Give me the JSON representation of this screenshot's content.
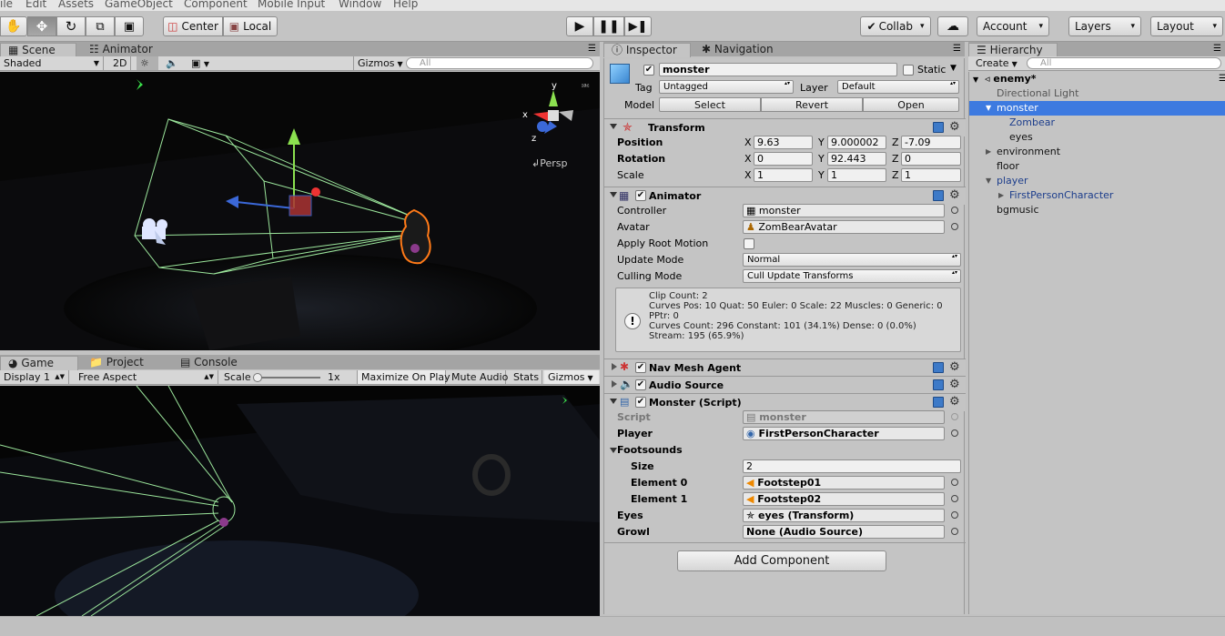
{
  "menu": [
    "ile",
    "Edit",
    "Assets",
    "GameObject",
    "Component",
    "Mobile Input",
    "Window",
    "Help"
  ],
  "toolbar": {
    "pivot_label": "Center",
    "space_label": "Local",
    "collab_label": "Collab",
    "account_label": "Account",
    "layers_label": "Layers",
    "layout_label": "Layout"
  },
  "scene": {
    "tabs": [
      "Scene",
      "Animator"
    ],
    "shading": "Shaded",
    "mode_2d": "2D",
    "gizmos": "Gizmos",
    "search_placeholder": "All",
    "persp_label": "Persp",
    "axis_y": "y",
    "axis_x": "x",
    "axis_z": "z"
  },
  "game": {
    "tabs": [
      "Game",
      "Project",
      "Console"
    ],
    "display": "Display 1",
    "aspect": "Free Aspect",
    "scale_label": "Scale",
    "scale_value": "1x",
    "maximize": "Maximize On Play",
    "mute": "Mute Audio",
    "stats": "Stats",
    "gizmos": "Gizmos"
  },
  "inspector": {
    "tabs": [
      "Inspector",
      "Navigation"
    ],
    "object_name": "monster",
    "static_label": "Static",
    "tag_label": "Tag",
    "tag_value": "Untagged",
    "layer_label": "Layer",
    "layer_value": "Default",
    "model_label": "Model",
    "model_buttons": [
      "Select",
      "Revert",
      "Open"
    ],
    "transform": {
      "title": "Transform",
      "position_label": "Position",
      "rotation_label": "Rotation",
      "scale_label": "Scale",
      "position": [
        "9.63",
        "9.000002",
        "-7.09"
      ],
      "rotation": [
        "0",
        "92.443",
        "0"
      ],
      "scale": [
        "1",
        "1",
        "1"
      ]
    },
    "animator": {
      "title": "Animator",
      "controller_label": "Controller",
      "controller_value": "monster",
      "avatar_label": "Avatar",
      "avatar_value": "ZomBearAvatar",
      "root_motion_label": "Apply Root Motion",
      "update_mode_label": "Update Mode",
      "update_mode_value": "Normal",
      "culling_label": "Culling Mode",
      "culling_value": "Cull Update Transforms",
      "info_lines": [
        "Clip Count: 2",
        "Curves Pos: 10 Quat: 50 Euler: 0 Scale: 22 Muscles: 0 Generic: 0",
        "PPtr: 0",
        "Curves Count: 296 Constant: 101 (34.1%) Dense: 0 (0.0%)",
        "Stream: 195 (65.9%)"
      ]
    },
    "nav_mesh_title": "Nav Mesh Agent",
    "audio_source_title": "Audio Source",
    "script": {
      "title": "Monster (Script)",
      "script_label": "Script",
      "script_value": "monster",
      "player_label": "Player",
      "player_value": "FirstPersonCharacter",
      "footsounds_label": "Footsounds",
      "size_label": "Size",
      "size_value": "2",
      "element0_label": "Element 0",
      "element0_value": "Footstep01",
      "element1_label": "Element 1",
      "element1_value": "Footstep02",
      "eyes_label": "Eyes",
      "eyes_value": "eyes (Transform)",
      "growl_label": "Growl",
      "growl_value": "None (Audio Source)"
    },
    "add_component": "Add Component"
  },
  "hierarchy": {
    "tab": "Hierarchy",
    "create": "Create",
    "search_placeholder": "All",
    "scene_name": "enemy*",
    "items": [
      {
        "label": "Directional Light",
        "indent": 0,
        "foldout": "none",
        "color": "gray"
      },
      {
        "label": "monster",
        "indent": 0,
        "foldout": "open",
        "color": "blue",
        "selected": true
      },
      {
        "label": "Zombear",
        "indent": 1,
        "foldout": "none",
        "color": "blue"
      },
      {
        "label": "eyes",
        "indent": 1,
        "foldout": "none",
        "color": "black"
      },
      {
        "label": "environment",
        "indent": 0,
        "foldout": "closed",
        "color": "black"
      },
      {
        "label": "floor",
        "indent": 0,
        "foldout": "none",
        "color": "black"
      },
      {
        "label": "player",
        "indent": 0,
        "foldout": "open",
        "color": "blue"
      },
      {
        "label": "FirstPersonCharacter",
        "indent": 1,
        "foldout": "closed",
        "color": "blue"
      },
      {
        "label": "bgmusic",
        "indent": 0,
        "foldout": "none",
        "color": "black"
      }
    ]
  },
  "colors": {
    "selection": "#3d7ae0",
    "prefab_blue": "#1d3e8c",
    "wire_green": "#8fe08f",
    "monster_outline": "#ff7a18"
  }
}
